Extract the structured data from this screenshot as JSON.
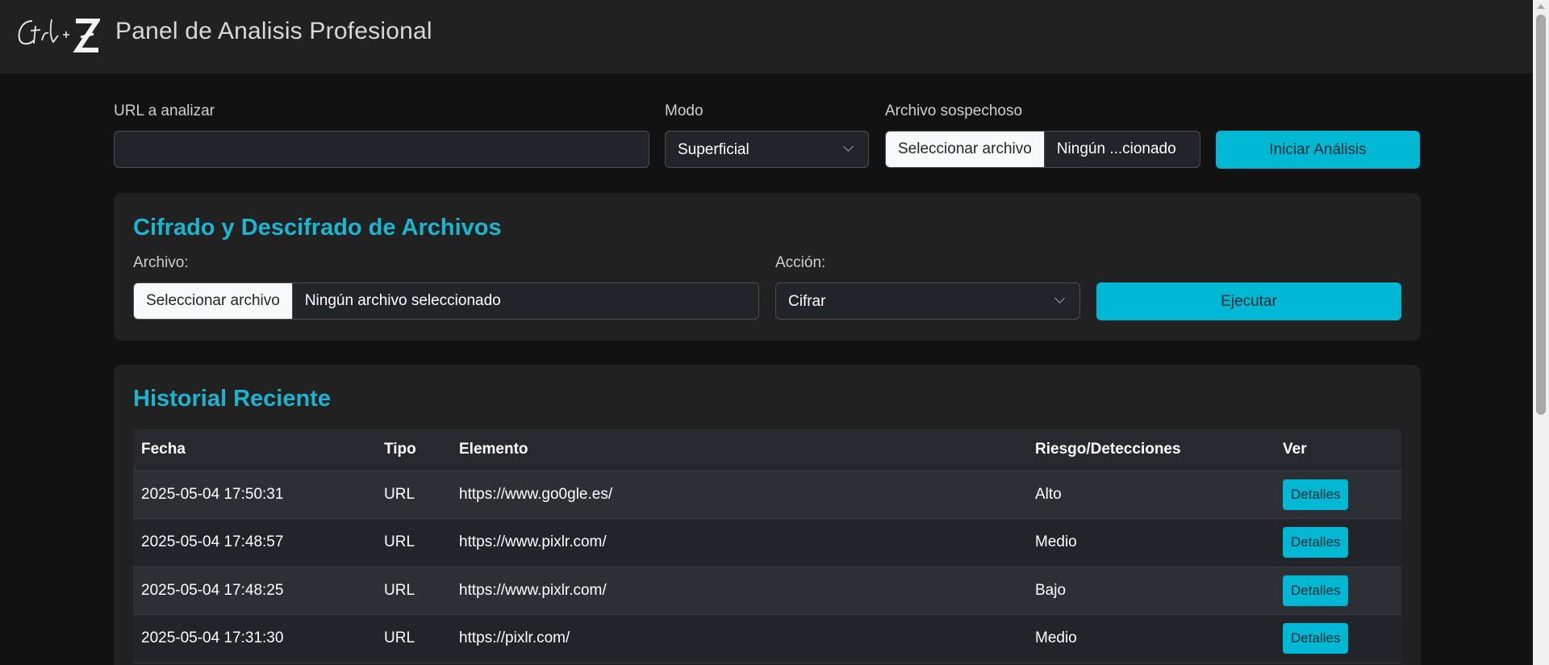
{
  "header": {
    "logo_text": "Ctrl + Z",
    "title": "Panel de Analisis Profesional"
  },
  "analysis": {
    "url_label": "URL a analizar",
    "url_value": "",
    "mode_label": "Modo",
    "mode_selected": "Superficial",
    "file_label": "Archivo sospechoso",
    "file_button": "Seleccionar archivo",
    "file_status": "Ningún ...cionado",
    "start_button": "Iniciar Análisis"
  },
  "crypto": {
    "title": "Cifrado y Descifrado de Archivos",
    "file_label": "Archivo:",
    "file_button": "Seleccionar archivo",
    "file_status": "Ningún archivo seleccionado",
    "action_label": "Acción:",
    "action_selected": "Cifrar",
    "execute_button": "Ejecutar"
  },
  "history": {
    "title": "Historial Reciente",
    "columns": [
      "Fecha",
      "Tipo",
      "Elemento",
      "Riesgo/Detecciones",
      "Ver"
    ],
    "details_label": "Detalles",
    "rows": [
      {
        "fecha": "2025-05-04 17:50:31",
        "tipo": "URL",
        "elemento": "https://www.go0gle.es/",
        "riesgo": "Alto"
      },
      {
        "fecha": "2025-05-04 17:48:57",
        "tipo": "URL",
        "elemento": "https://www.pixlr.com/",
        "riesgo": "Medio"
      },
      {
        "fecha": "2025-05-04 17:48:25",
        "tipo": "URL",
        "elemento": "https://www.pixlr.com/",
        "riesgo": "Bajo"
      },
      {
        "fecha": "2025-05-04 17:31:30",
        "tipo": "URL",
        "elemento": "https://pixlr.com/",
        "riesgo": "Medio"
      }
    ]
  },
  "colors": {
    "accent": "#00b8d4",
    "background": "#121212",
    "panel": "#212121"
  }
}
